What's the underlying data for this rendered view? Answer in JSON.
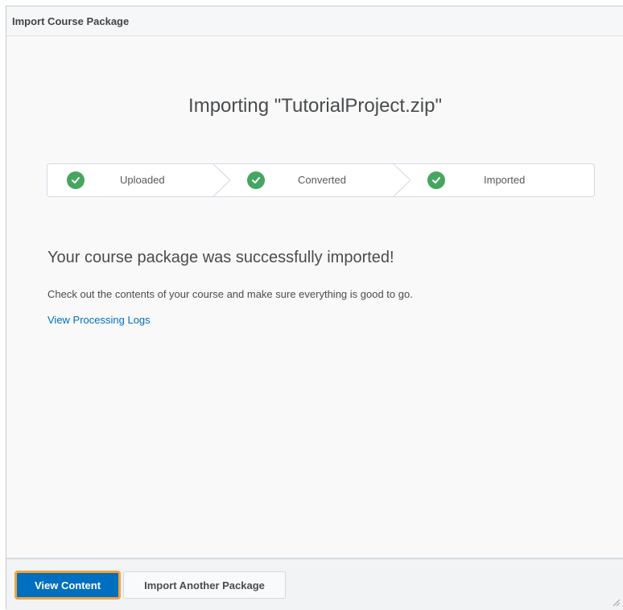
{
  "dialog": {
    "title": "Import Course Package"
  },
  "main": {
    "heading": "Importing \"TutorialProject.zip\"",
    "steps": [
      {
        "label": "Uploaded",
        "status": "complete"
      },
      {
        "label": "Converted",
        "status": "complete"
      },
      {
        "label": "Imported",
        "status": "complete"
      }
    ],
    "success_message": "Your course package was successfully imported!",
    "description": "Check out the contents of your course and make sure everything is good to go.",
    "logs_link": "View Processing Logs"
  },
  "footer": {
    "primary_button": "View Content",
    "secondary_button": "Import Another Package"
  },
  "colors": {
    "accent": "#006fbf",
    "success": "#46a661",
    "focus_ring": "#f6a336"
  },
  "icons": {
    "step_status": "check-circle-icon",
    "separator": "chevron-right-icon",
    "resize": "resize-grip-icon"
  }
}
